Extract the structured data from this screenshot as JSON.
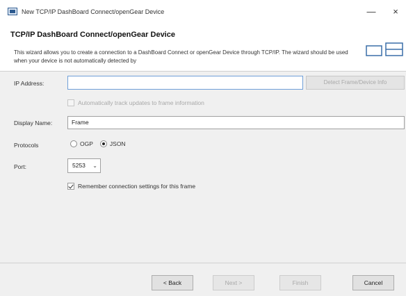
{
  "window": {
    "title": "New TCP/IP DashBoard Connect/openGear Device",
    "icon": "app-window-icon",
    "minimize_label": "—",
    "close_label": "×"
  },
  "header": {
    "title": "TCP/IP DashBoard Connect/openGear Device",
    "description": "This wizard allows you to create a connection to a DashBoard Connect or openGear Device through TCP/IP. The wizard should be used when your device is not automatically detected by",
    "icon": "device-icon"
  },
  "form": {
    "ip_address": {
      "label": "IP Address:",
      "value": "",
      "detect_button_label": "Detect Frame/Device Info"
    },
    "auto_track": {
      "label": "Automatically track updates to frame information",
      "checked": false,
      "enabled": false
    },
    "display_name": {
      "label": "Display Name:",
      "value": "Frame"
    },
    "protocols": {
      "label": "Protocols",
      "options": [
        {
          "label": "OGP",
          "selected": false
        },
        {
          "label": "JSON",
          "selected": true
        }
      ]
    },
    "port": {
      "label": "Port:",
      "value": "5253"
    },
    "remember": {
      "label": "Remember connection settings for this frame",
      "checked": true
    }
  },
  "footer": {
    "back_label": "< Back",
    "next_label": "Next >",
    "finish_label": "Finish",
    "cancel_label": "Cancel"
  }
}
